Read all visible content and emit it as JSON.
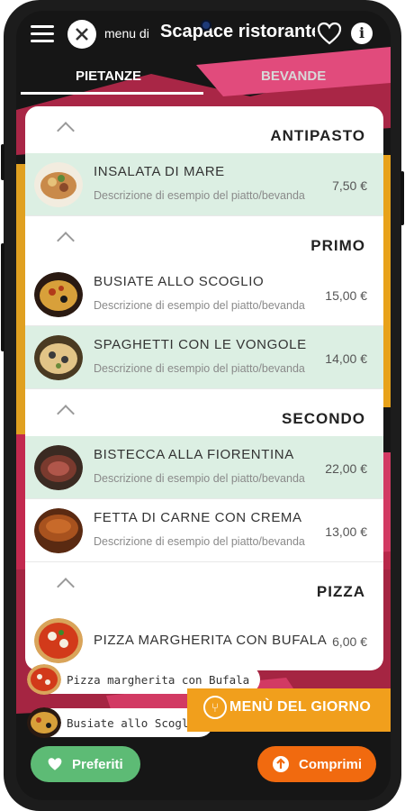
{
  "header": {
    "menu_prefix": "menu di",
    "restaurant_name": "Scapace ristorante",
    "info_symbol": "i"
  },
  "tabs": [
    {
      "label": "PIETANZE",
      "active": true
    },
    {
      "label": "BEVANDE",
      "active": false
    }
  ],
  "sections": [
    {
      "title": "ANTIPASTO",
      "items": [
        {
          "name": "INSALATA DI MARE",
          "description": "Descrizione di esempio del piatto/bevanda",
          "price": "7,50 €",
          "highlighted": true
        }
      ]
    },
    {
      "title": "PRIMO",
      "items": [
        {
          "name": "BUSIATE ALLO SCOGLIO",
          "description": "Descrizione di esempio del piatto/bevanda",
          "price": "15,00 €",
          "highlighted": false
        },
        {
          "name": "SPAGHETTI CON LE VONGOLE",
          "description": "Descrizione di esempio del piatto/bevanda",
          "price": "14,00 €",
          "highlighted": true
        }
      ]
    },
    {
      "title": "SECONDO",
      "items": [
        {
          "name": "BISTECCA ALLA FIORENTINA",
          "description": "Descrizione di esempio del piatto/bevanda",
          "price": "22,00 €",
          "highlighted": true
        },
        {
          "name": "FETTA DI CARNE CON CREMA",
          "description": "Descrizione di esempio del piatto/bevanda",
          "price": "13,00 €",
          "highlighted": false
        }
      ]
    },
    {
      "title": "PIZZA",
      "items": [
        {
          "name": "PIZZA MARGHERITA CON BUFALA",
          "description": "",
          "price": "6,00 €",
          "highlighted": false
        }
      ]
    }
  ],
  "toasts": [
    {
      "label": "Pizza margherita con Bufala"
    },
    {
      "label": "Busiate allo Scoglio"
    }
  ],
  "banner": {
    "label": "MENÙ DEL GIORNO"
  },
  "buttons": {
    "favorites": "Preferiti",
    "buy": "Comprimi"
  },
  "colors": {
    "highlight_row": "#dcefe3",
    "favorites_button": "#5dbb75",
    "buy_button": "#f16a0f",
    "banner": "#f19f1c"
  }
}
